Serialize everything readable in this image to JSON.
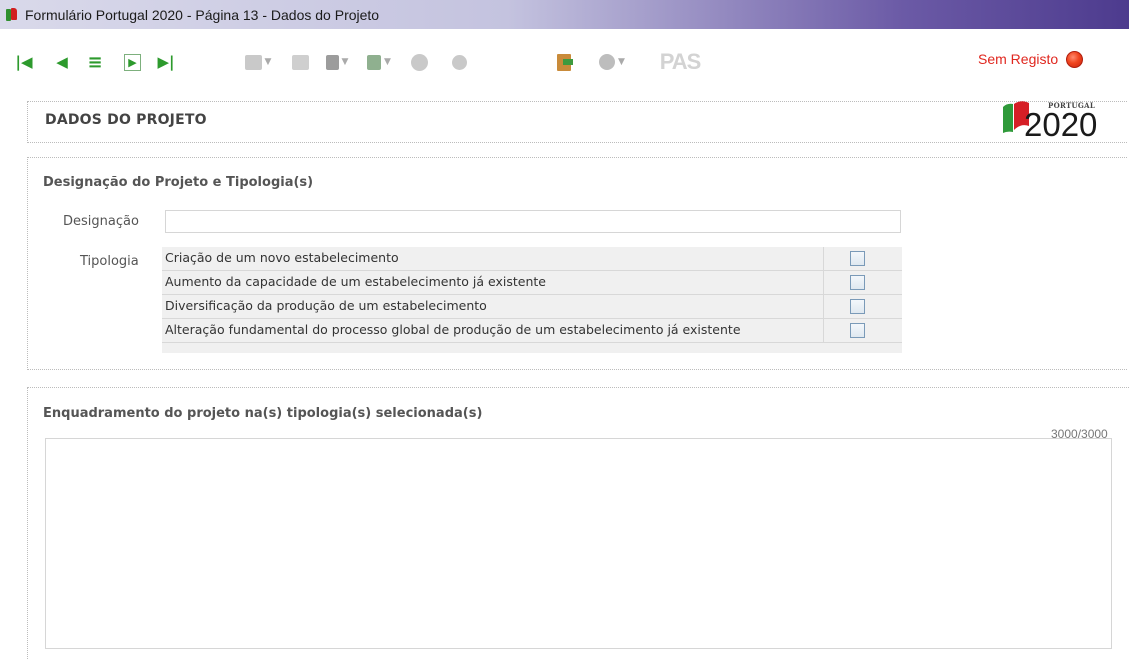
{
  "window": {
    "title": "Formulário Portugal 2020 - Página 13 - Dados do Projeto",
    "icon": "portugal-flag-icon"
  },
  "toolbar": {
    "nav": [
      {
        "name": "first-page-icon",
        "glyph": "|◀"
      },
      {
        "name": "previous-page-icon",
        "glyph": "◀"
      },
      {
        "name": "menu-icon",
        "glyph": "≡"
      },
      {
        "name": "next-page-icon",
        "glyph": "▶"
      },
      {
        "name": "last-page-icon",
        "glyph": "▶|"
      }
    ],
    "pas_label": "PAS",
    "status_label": "Sem Registo",
    "status_color": "#e0271f"
  },
  "header": {
    "title": "DADOS DO PROJETO",
    "logo_small": "PORTUGAL",
    "logo_year": "2020"
  },
  "section_designacao": {
    "title": "Designação do Projeto e Tipologia(s)",
    "designacao_label": "Designação",
    "designacao_value": "",
    "tipologia_label": "Tipologia",
    "tipologias": [
      {
        "label": "Criação de um novo estabelecimento",
        "checked": false
      },
      {
        "label": "Aumento da capacidade de um estabelecimento já existente",
        "checked": false
      },
      {
        "label": "Diversificação da produção de um estabelecimento",
        "checked": false
      },
      {
        "label": "Alteração fundamental do processo global de produção de um estabelecimento já existente",
        "checked": false
      }
    ]
  },
  "section_enquadramento": {
    "title": "Enquadramento do projeto na(s) tipologia(s) selecionada(s)",
    "counter": "3000/3000",
    "text_value": ""
  }
}
